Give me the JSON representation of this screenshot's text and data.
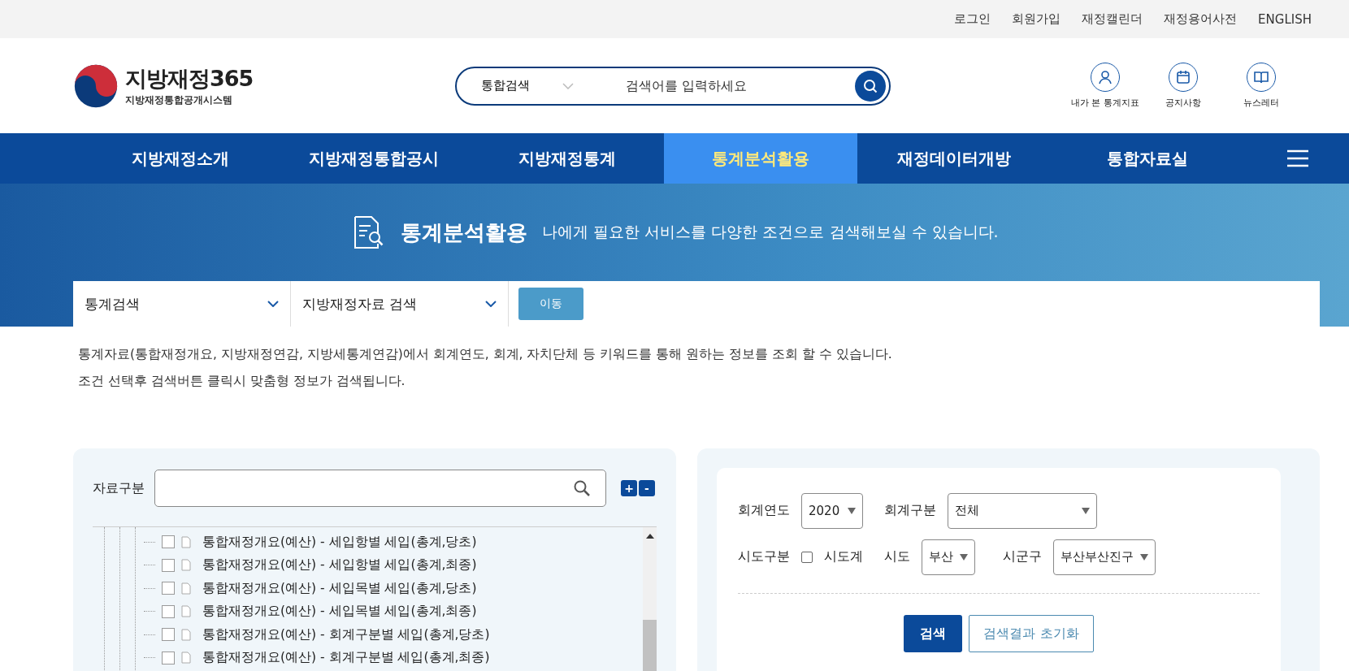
{
  "top_links": [
    "로그인",
    "회원가입",
    "재정캘린더",
    "재정용어사전",
    "ENGLISH"
  ],
  "logo": {
    "title": "지방재정365",
    "subtitle": "지방재정통합공개시스템"
  },
  "search": {
    "category": "통합검색",
    "placeholder": "검색어를 입력하세요"
  },
  "quick_links": [
    {
      "kind": "person",
      "label": "내가 본 통계지표"
    },
    {
      "kind": "calendar",
      "label": "공지사항"
    },
    {
      "kind": "book",
      "label": "뉴스레터"
    }
  ],
  "nav": [
    {
      "label": "지방재정소개",
      "selected": false
    },
    {
      "label": "지방재정통합공시",
      "selected": false
    },
    {
      "label": "지방재정통계",
      "selected": false
    },
    {
      "label": "통계분석활용",
      "selected": true
    },
    {
      "label": "재정데이터개방",
      "selected": false
    },
    {
      "label": "통합자료실",
      "selected": false
    }
  ],
  "banner": {
    "title": "통계분석활용",
    "description": "나에게 필요한 서비스를 다양한 조건으로 검색해보실 수 있습니다."
  },
  "jump": {
    "selects": [
      "통계검색",
      "지방재정자료 검색"
    ],
    "button": "이동"
  },
  "notes": [
    "통계자료(통합재정개요, 지방재정연감, 지방세통계연감)에서 회계연도, 회계, 자치단체 등 키워드를 통해 원하는 정보를 조회 할 수 있습니다.",
    "조건 선택후 검색버튼 클릭시 맞춤형 정보가 검색됩니다."
  ],
  "tree_panel": {
    "label": "자료구분",
    "expand": "+",
    "collapse": "-",
    "items": [
      {
        "label": "통합재정개요(예산) - 세입항별 세입(총계,당초)",
        "checked": false
      },
      {
        "label": "통합재정개요(예산) - 세입항별 세입(총계,최종)",
        "checked": false
      },
      {
        "label": "통합재정개요(예산) - 세입목별 세입(총계,당초)",
        "checked": false
      },
      {
        "label": "통합재정개요(예산) - 세입목별 세입(총계,최종)",
        "checked": false
      },
      {
        "label": "통합재정개요(예산) - 회계구분별 세입(총계,당초)",
        "checked": false
      },
      {
        "label": "통합재정개요(예산) - 회계구분별 세입(총계,최종)",
        "checked": false
      }
    ]
  },
  "filters": {
    "year_label": "회계연도",
    "year": "2020",
    "account_label": "회계구분",
    "account": "전체",
    "region_type_label": "시도구분",
    "province_total": {
      "label": "시도계",
      "checked": false
    },
    "province_label": "시도",
    "province": "부산",
    "district_label": "시군구",
    "district": "부산부산진구",
    "search_button": "검색",
    "reset_button": "검색결과 초기화"
  }
}
